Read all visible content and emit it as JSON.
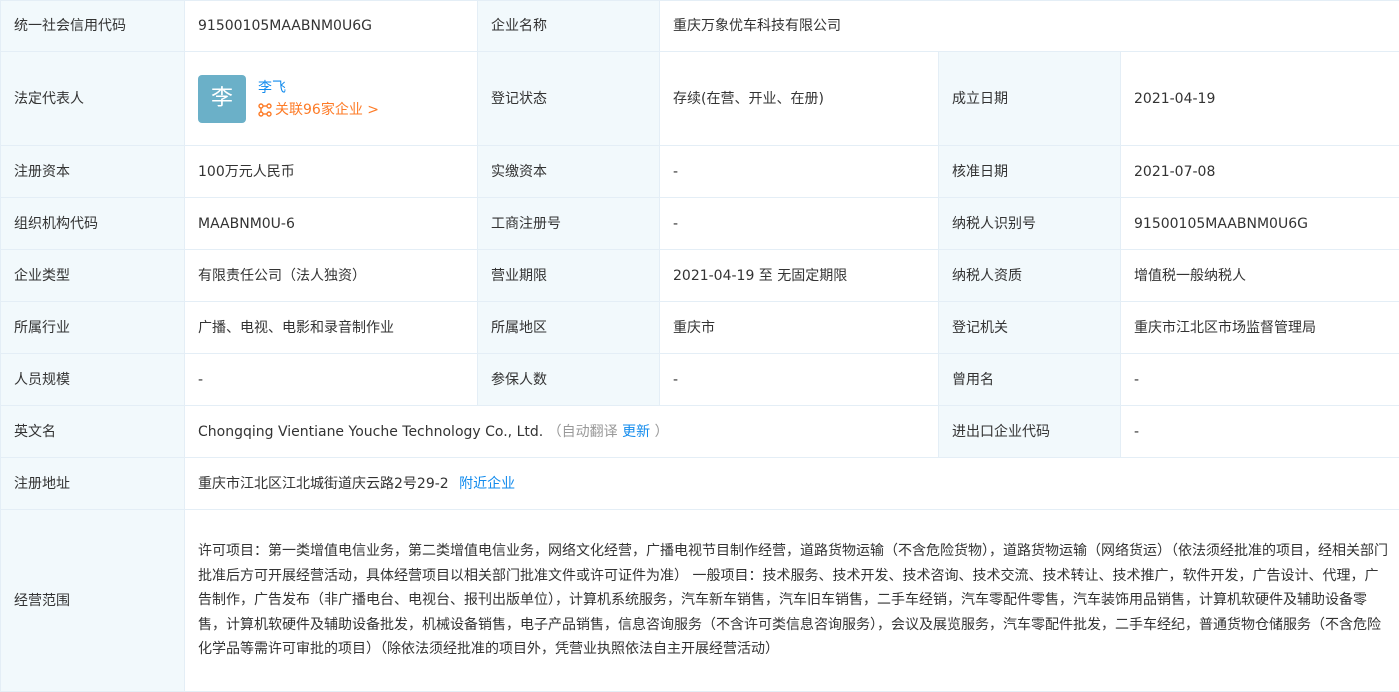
{
  "labels": {
    "credit_code": "统一社会信用代码",
    "company_name": "企业名称",
    "legal_rep": "法定代表人",
    "reg_status": "登记状态",
    "est_date": "成立日期",
    "reg_capital": "注册资本",
    "paid_capital": "实缴资本",
    "approval_date": "核准日期",
    "org_code": "组织机构代码",
    "biz_reg_no": "工商注册号",
    "taxpayer_id": "纳税人识别号",
    "company_type": "企业类型",
    "biz_term": "营业期限",
    "taxpayer_qual": "纳税人资质",
    "industry": "所属行业",
    "region": "所属地区",
    "reg_authority": "登记机关",
    "staff_size": "人员规模",
    "insured_count": "参保人数",
    "former_name": "曾用名",
    "english_name": "英文名",
    "import_export_code": "进出口企业代码",
    "reg_address": "注册地址",
    "biz_scope": "经营范围"
  },
  "values": {
    "credit_code": "91500105MAABNM0U6G",
    "company_name": "重庆万象优车科技有限公司",
    "legal_rep_avatar": "李",
    "legal_rep_name": "李飞",
    "legal_rep_related": "关联96家企业 >",
    "reg_status": "存续(在营、开业、在册)",
    "est_date": "2021-04-19",
    "reg_capital": "100万元人民币",
    "paid_capital": "-",
    "approval_date": "2021-07-08",
    "org_code": "MAABNM0U-6",
    "biz_reg_no": "-",
    "taxpayer_id": "91500105MAABNM0U6G",
    "company_type": "有限责任公司（法人独资）",
    "biz_term": "2021-04-19 至 无固定期限",
    "taxpayer_qual": "增值税一般纳税人",
    "industry": "广播、电视、电影和录音制作业",
    "region": "重庆市",
    "reg_authority": "重庆市江北区市场监督管理局",
    "staff_size": "-",
    "insured_count": "-",
    "former_name": "-",
    "english_name": "Chongqing Vientiane Youche Technology Co., Ltd.",
    "english_note_open": "（自动翻译 ",
    "english_update": "更新",
    "english_note_close": " ）",
    "import_export_code": "-",
    "reg_address": "重庆市江北区江北城街道庆云路2号29-2",
    "nearby_link": "附近企业",
    "biz_scope": "许可项目：第一类增值电信业务，第二类增值电信业务，网络文化经营，广播电视节目制作经营，道路货物运输（不含危险货物），道路货物运输（网络货运）（依法须经批准的项目，经相关部门批准后方可开展经营活动，具体经营项目以相关部门批准文件或许可证件为准） 一般项目：技术服务、技术开发、技术咨询、技术交流、技术转让、技术推广，软件开发，广告设计、代理，广告制作，广告发布（非广播电台、电视台、报刊出版单位），计算机系统服务，汽车新车销售，汽车旧车销售，二手车经销，汽车零配件零售，汽车装饰用品销售，计算机软硬件及辅助设备零售，计算机软硬件及辅助设备批发，机械设备销售，电子产品销售，信息咨询服务（不含许可类信息咨询服务），会议及展览服务，汽车零配件批发，二手车经纪，普通货物仓储服务（不含危险化学品等需许可审批的项目）（除依法须经批准的项目外，凭营业执照依法自主开展经营活动）"
  },
  "colors": {
    "label_bg": "#f2f9fc",
    "border": "#e4eef6",
    "link_blue": "#128bed",
    "link_orange": "#fd7b27",
    "avatar_bg": "#6bb0c8"
  },
  "icons": {
    "related_link": "network-icon"
  }
}
